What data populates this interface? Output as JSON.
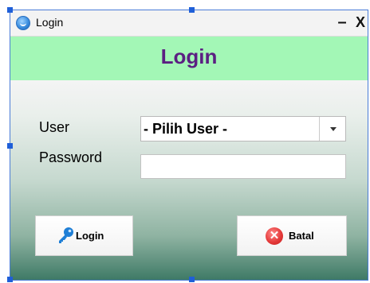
{
  "window": {
    "title": "Login",
    "minimize_glyph": "–",
    "close_glyph": "X",
    "icon": "app-icon"
  },
  "header": {
    "title": "Login",
    "title_color": "#5b1f82",
    "background": "#a3f7b6"
  },
  "form": {
    "user_label": "User",
    "user_select": {
      "selected": "- Pilih User -",
      "icon": "chevron-down-icon"
    },
    "password_label": "Password",
    "password_value": ""
  },
  "buttons": {
    "login": {
      "label": "Login",
      "icon": "key-icon"
    },
    "batal": {
      "label": "Batal",
      "icon": "close-circle-icon",
      "icon_glyph": "✕"
    }
  }
}
